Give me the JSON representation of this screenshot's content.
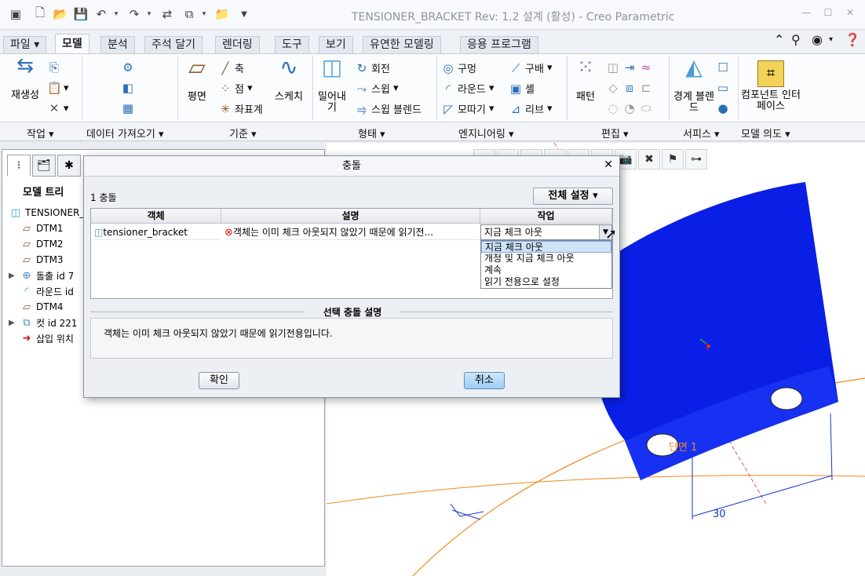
{
  "window": {
    "title": "TENSIONER_BRACKET Rev: 1.2 설계 (활성) - Creo Parametric"
  },
  "tabs": [
    {
      "label": "파일"
    },
    {
      "label": "모델"
    },
    {
      "label": "분석"
    },
    {
      "label": "주석 달기"
    },
    {
      "label": "렌더링"
    },
    {
      "label": "도구"
    },
    {
      "label": "보기"
    },
    {
      "label": "유연한 모델링"
    },
    {
      "label": "응용 프로그램"
    }
  ],
  "ribbon": {
    "regenerate": "재생성",
    "axis": "축",
    "point": "점",
    "coordsys": "좌표계",
    "plane": "평면",
    "sketch": "스케치",
    "extrude": "밀어내기",
    "revolve": "회전",
    "sweep": "스윕",
    "swept_blend": "스윕 블렌드",
    "hole": "구멍",
    "round": "라운드",
    "chamfer": "모따기",
    "draft": "구배",
    "shell": "셸",
    "rib": "리브",
    "pattern": "패턴",
    "boundary_blend": "경계 블렌드",
    "component_interface": "컴포넌트 인터페이스",
    "groups": [
      {
        "label": "작업"
      },
      {
        "label": "데이터 가져오기"
      },
      {
        "label": "기준"
      },
      {
        "label": "형태"
      },
      {
        "label": "엔지니어링"
      },
      {
        "label": "편집"
      },
      {
        "label": "서피스"
      },
      {
        "label": "모델 의도"
      }
    ]
  },
  "model_tree": {
    "title": "모델 트리",
    "items": [
      {
        "label": "TENSIONER_"
      },
      {
        "label": "DTM1"
      },
      {
        "label": "DTM2"
      },
      {
        "label": "DTM3"
      },
      {
        "label": "돌출 id 7"
      },
      {
        "label": "라운드 id"
      },
      {
        "label": "DTM4"
      },
      {
        "label": "컷 id 221"
      },
      {
        "label": "삽입 위치"
      }
    ]
  },
  "dialog": {
    "title": "충돌",
    "count": "1 충돌",
    "set_all": "전체 설정",
    "columns": [
      "객체",
      "설명",
      "작업"
    ],
    "row": {
      "object": "tensioner_bracket",
      "description": "객체는 이미 체크 아웃되지 않았기 때문에 읽기전...",
      "action": "지금 체크 아웃"
    },
    "options": [
      "지금 체크 아웃",
      "개정 및 지금 체크 아웃",
      "계속",
      "읽기 전용으로 설정"
    ],
    "section_title": "선택 충돌 설명",
    "section_text": "객체는 이미 체크 아웃되지 않았기 때문에 읽기전용입니다.",
    "ok": "확인",
    "cancel": "취소"
  },
  "viewport": {
    "section_label": "단면 1",
    "dimension": "30"
  },
  "colors": {
    "part_blue": "#0a1fe6",
    "datum_orange": "#f08a1c",
    "dim_blue": "#1a35c9"
  }
}
